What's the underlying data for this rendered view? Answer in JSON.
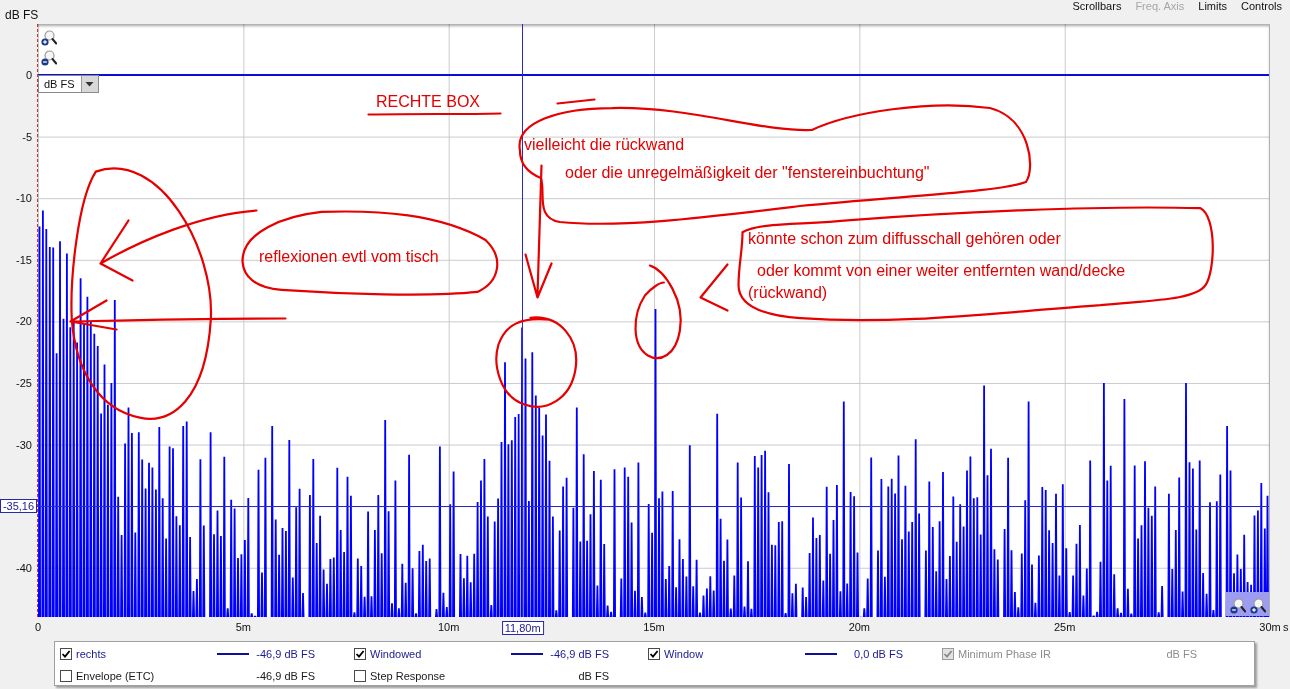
{
  "graph_buttons": [
    {
      "label": "Scrollbars",
      "disabled": false
    },
    {
      "label": "Freq. Axis",
      "disabled": true
    },
    {
      "label": "Limits",
      "disabled": false
    },
    {
      "label": "Controls",
      "disabled": false
    }
  ],
  "y_axis": {
    "unit": "dB FS",
    "ticks": [
      {
        "kind": "tick",
        "label": "0"
      },
      {
        "kind": "tick",
        "label": "-5"
      },
      {
        "kind": "tick",
        "label": "-10"
      },
      {
        "kind": "tick",
        "label": "-15"
      },
      {
        "kind": "tick",
        "label": "-20"
      },
      {
        "kind": "tick",
        "label": "-25"
      },
      {
        "kind": "tick",
        "label": "-30"
      },
      {
        "kind": "cursor",
        "label": "-35,16"
      },
      {
        "kind": "tick",
        "label": "-40"
      }
    ]
  },
  "unit_dropdown": {
    "value": "dB FS"
  },
  "x_axis": {
    "ticks": [
      "0",
      "5m",
      "10m",
      "15m",
      "20m",
      "25m",
      "30m"
    ],
    "unit": "s",
    "cursor": "11,80m"
  },
  "annotations": {
    "title": "RECHTE BOX",
    "notes": [
      "vielleicht die rückwand",
      "oder die unregelmäßigkeit der \"fenstereinbuchtung\"",
      "reflexionen evtl vom tisch",
      "könnte schon zum diffusschall gehören oder",
      "oder kommt von einer weiter entfernten wand/decke",
      "(rückwand)"
    ]
  },
  "legend": [
    {
      "label": "rechts",
      "checked": true,
      "disabled": false,
      "reading": "-46,9 dB FS"
    },
    {
      "label": "Windowed",
      "checked": true,
      "disabled": false,
      "reading": "-46,9 dB FS"
    },
    {
      "label": "Window",
      "checked": true,
      "disabled": false,
      "reading": "0,0 dB FS"
    },
    {
      "label": "Minimum Phase IR",
      "checked": true,
      "disabled": true,
      "reading": "dB FS"
    },
    {
      "label": "Envelope (ETC)",
      "checked": false,
      "disabled": false,
      "reading": "-46,9 dB FS"
    },
    {
      "label": "Step Response",
      "checked": false,
      "disabled": false,
      "reading": "dB FS"
    }
  ]
}
